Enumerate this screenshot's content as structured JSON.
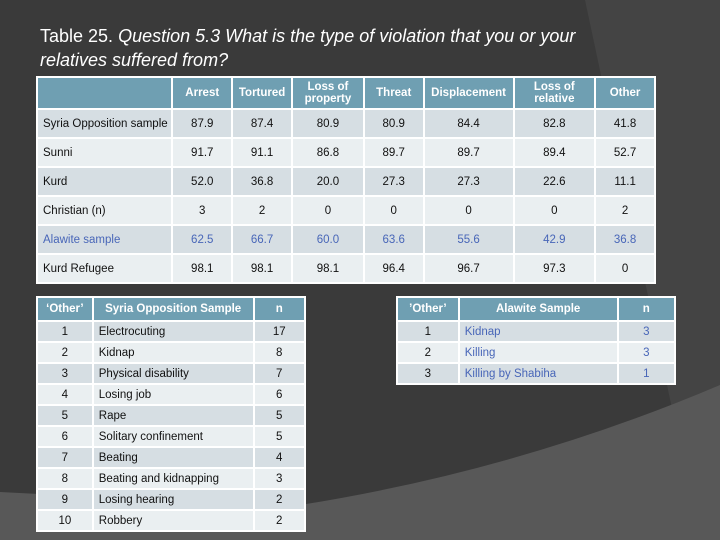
{
  "title": {
    "lead": "Table 25.",
    "question": "Question 5.3 What is the type of violation that you or your relatives suffered from?"
  },
  "main_table": {
    "columns": [
      "",
      "Arrest",
      "Tortured",
      "Loss of property",
      "Threat",
      "Displacement",
      "Loss of relative",
      "Other"
    ],
    "rows": [
      {
        "label": "Syria Opposition sample",
        "values": [
          "87.9",
          "87.4",
          "80.9",
          "80.9",
          "84.4",
          "82.8",
          "41.8"
        ]
      },
      {
        "label": "Sunni",
        "values": [
          "91.7",
          "91.1",
          "86.8",
          "89.7",
          "89.7",
          "89.4",
          "52.7"
        ]
      },
      {
        "label": "Kurd",
        "values": [
          "52.0",
          "36.8",
          "20.0",
          "27.3",
          "27.3",
          "22.6",
          "11.1"
        ]
      },
      {
        "label": "Christian (n)",
        "values": [
          "3",
          "2",
          "0",
          "0",
          "0",
          "0",
          "2"
        ]
      },
      {
        "label": "Alawite sample",
        "values": [
          "62.5",
          "66.7",
          "60.0",
          "63.6",
          "55.6",
          "42.9",
          "36.8"
        ]
      },
      {
        "label": "Kurd Refugee",
        "values": [
          "98.1",
          "98.1",
          "98.1",
          "96.4",
          "96.7",
          "97.3",
          "0"
        ]
      }
    ]
  },
  "other_syria": {
    "columns": [
      "‘Other’",
      "Syria Opposition Sample",
      "n"
    ],
    "rows": [
      {
        "rank": "1",
        "item": "Electrocuting",
        "n": "17"
      },
      {
        "rank": "2",
        "item": "Kidnap",
        "n": "8"
      },
      {
        "rank": "3",
        "item": "Physical disability",
        "n": "7"
      },
      {
        "rank": "4",
        "item": "Losing job",
        "n": "6"
      },
      {
        "rank": "5",
        "item": "Rape",
        "n": "5"
      },
      {
        "rank": "6",
        "item": "Solitary confinement",
        "n": "5"
      },
      {
        "rank": "7",
        "item": "Beating",
        "n": "4"
      },
      {
        "rank": "8",
        "item": "Beating and kidnapping",
        "n": "3"
      },
      {
        "rank": "9",
        "item": "Losing hearing",
        "n": "2"
      },
      {
        "rank": "10",
        "item": "Robbery",
        "n": "2"
      }
    ]
  },
  "other_alawite": {
    "columns": [
      "’Other’",
      "Alawite Sample",
      "n"
    ],
    "rows": [
      {
        "rank": "1",
        "item": "Kidnap",
        "n": "3"
      },
      {
        "rank": "2",
        "item": "Killing",
        "n": "3"
      },
      {
        "rank": "3",
        "item": "Killing by Shabiha",
        "n": "1"
      }
    ]
  },
  "colors": {
    "background": "#3a3a3a",
    "header": "#6f9fb2",
    "row_odd": "#d6dee3",
    "row_even": "#eaeff1",
    "alawite_text": "#4866b8"
  }
}
